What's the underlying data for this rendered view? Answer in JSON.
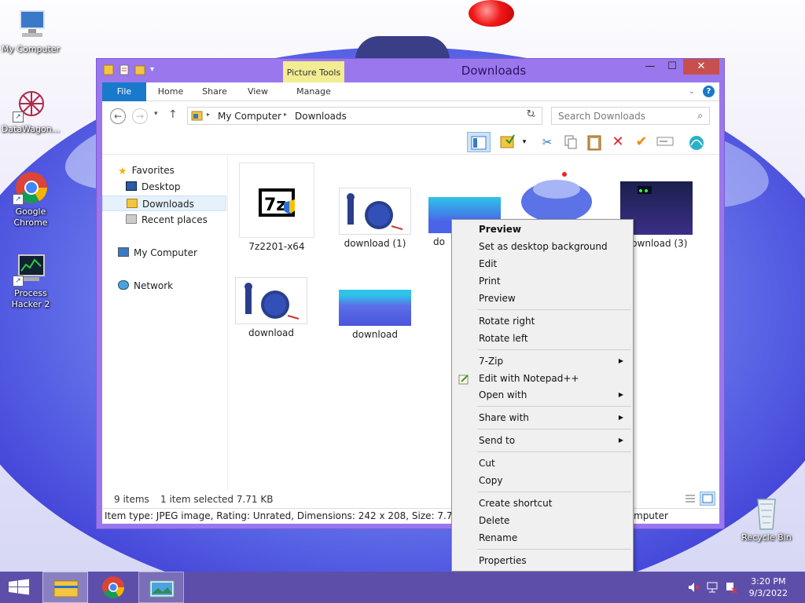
{
  "desktop": {
    "icons": [
      {
        "label": "My Computer"
      },
      {
        "label": "DataWagon..."
      },
      {
        "label": "Google Chrome"
      },
      {
        "label": "Process Hacker 2"
      },
      {
        "label": "Recycle Bin"
      }
    ]
  },
  "window": {
    "title": "Downloads",
    "picture_tools_label": "Picture Tools",
    "caption": {
      "minimize": "—",
      "maximize": "☐",
      "close": "✕"
    },
    "ribbon_tabs": [
      "File",
      "Home",
      "Share",
      "View",
      "Manage"
    ],
    "address": {
      "parts": [
        "My Computer",
        "Downloads"
      ],
      "separator": "▸"
    },
    "search_placeholder": "Search Downloads",
    "nav": {
      "favorites": "Favorites",
      "desktop": "Desktop",
      "downloads": "Downloads",
      "recent": "Recent places",
      "my_computer": "My Computer",
      "network": "Network"
    },
    "files": [
      {
        "name": "7z2201-x64"
      },
      {
        "name": "download (1)"
      },
      {
        "name": "do"
      },
      {
        "name": ""
      },
      {
        "name": "download (3)"
      },
      {
        "name": "download"
      },
      {
        "name": "download"
      }
    ],
    "status": {
      "item_count": "9 items",
      "selection": "1 item selected  7.71 KB",
      "details": "Item type: JPEG image, Rating: Unrated, Dimensions: 242 x 208, Size: 7.71 KB",
      "details_right": "mputer"
    }
  },
  "context_menu": {
    "items": [
      {
        "label": "Preview",
        "bold": true
      },
      {
        "label": "Set as desktop background"
      },
      {
        "label": "Edit"
      },
      {
        "label": "Print"
      },
      {
        "label": "Preview"
      },
      {
        "label": "Rotate right"
      },
      {
        "label": "Rotate left"
      },
      {
        "label": "7-Zip",
        "submenu": true
      },
      {
        "label": "Edit with Notepad++"
      },
      {
        "label": "Open with",
        "submenu": true
      },
      {
        "label": "Share with",
        "submenu": true
      },
      {
        "label": "Send to",
        "submenu": true
      },
      {
        "label": "Cut"
      },
      {
        "label": "Copy"
      },
      {
        "label": "Create shortcut"
      },
      {
        "label": "Delete"
      },
      {
        "label": "Rename"
      },
      {
        "label": "Properties"
      }
    ]
  },
  "taskbar": {
    "time": "3:20 PM",
    "date": "9/3/2022"
  },
  "colors": {
    "window_frame": "#9a77ec",
    "file_tab": "#1979ca",
    "picture_tools": "#f2ec92",
    "close_button": "#c7504e",
    "taskbar": "#5d4fa9"
  }
}
